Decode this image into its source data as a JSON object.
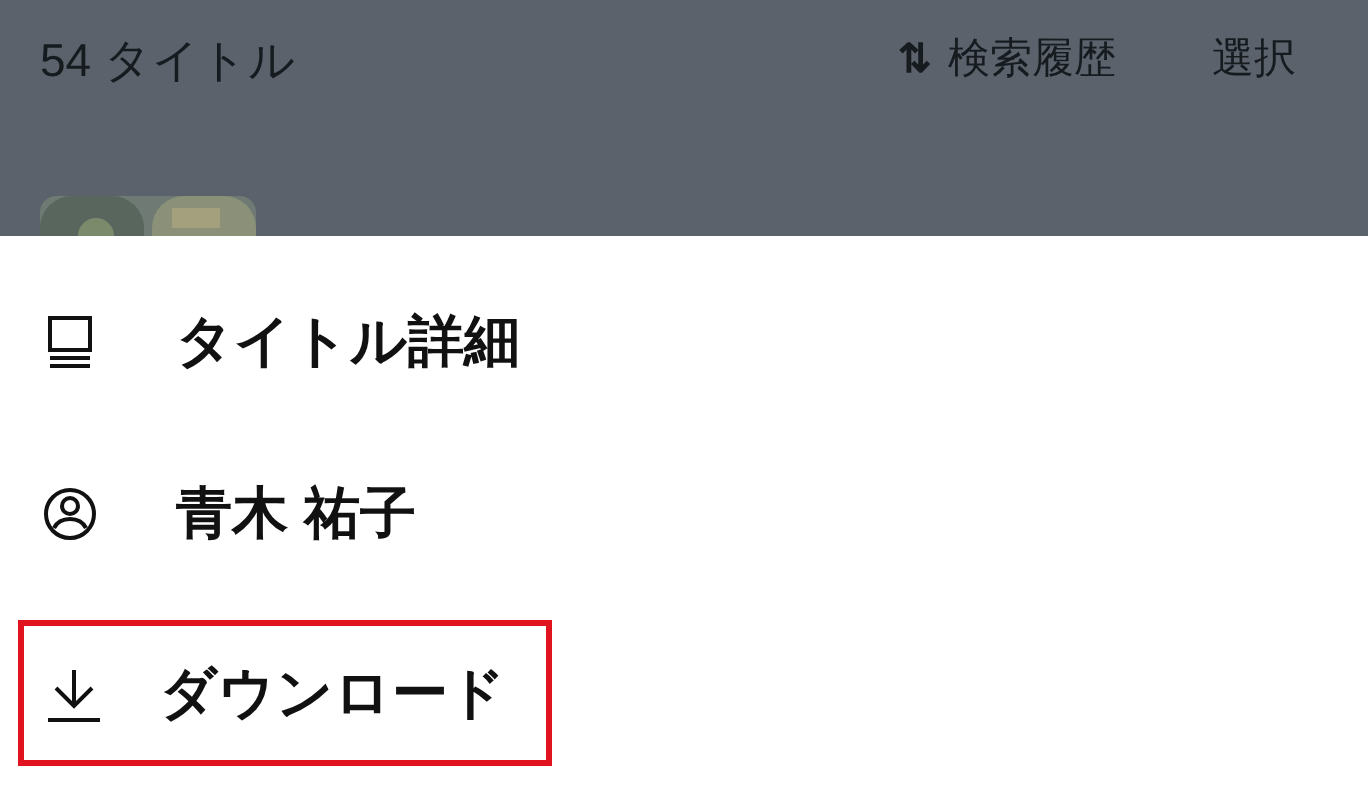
{
  "header": {
    "count": "54 タイトル",
    "sort_icon": "⇅",
    "history": "検索履歴",
    "select": "選択"
  },
  "sheet": {
    "items": [
      {
        "kind": "book",
        "label": "タイトル詳細",
        "highlighted": false
      },
      {
        "kind": "person",
        "label": "青木 祐子",
        "highlighted": false
      },
      {
        "kind": "download",
        "label": "ダウンロード",
        "highlighted": true
      }
    ]
  }
}
